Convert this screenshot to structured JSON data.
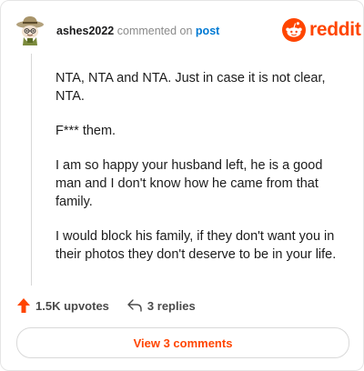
{
  "comment": {
    "username": "ashes2022",
    "action_text": "commented on",
    "post_link": "post",
    "paragraphs": [
      "NTA, NTA and NTA. Just in case it is not clear, NTA.",
      "F*** them.",
      "I am so happy your husband left, he is a good man and I don't know how he came from that family.",
      "I would block his family, if they don't want you in their photos they don't deserve to be in your life."
    ]
  },
  "brand": {
    "name": "reddit",
    "color": "#ff4500",
    "icon": "reddit-logo-icon"
  },
  "actions": {
    "upvotes_label": "1.5K upvotes",
    "replies_label": "3 replies"
  },
  "footer": {
    "view_comments_label": "View 3 comments"
  },
  "colors": {
    "accent": "#ff4500",
    "link": "#0079d3",
    "text": "#1c1c1c"
  }
}
